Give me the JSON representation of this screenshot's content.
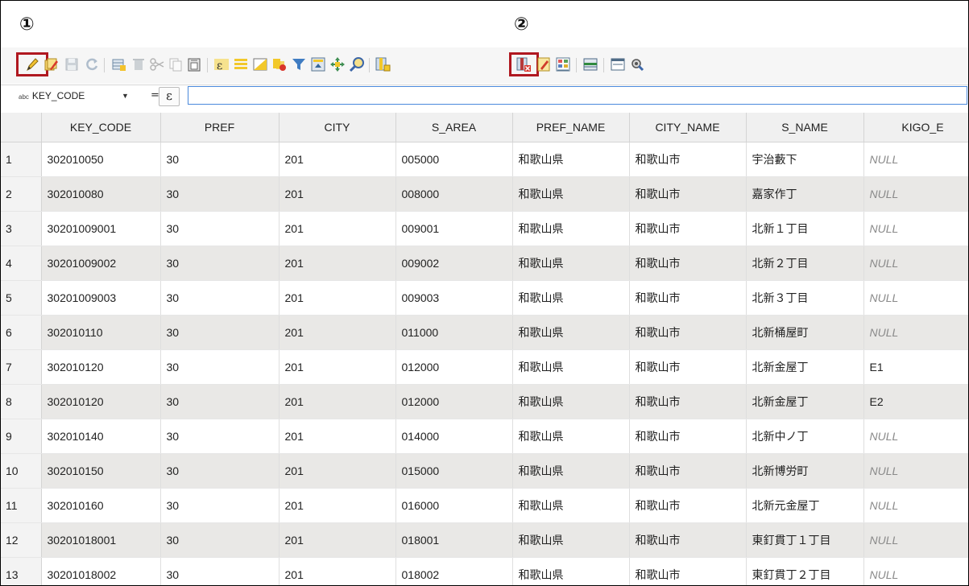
{
  "annotations": [
    "①",
    "②"
  ],
  "toolbar": {
    "icons": [
      "toggle-editing-icon",
      "multi-edit-icon",
      "save-edits-icon",
      "reload-icon",
      "add-feature-icon",
      "delete-feature-icon",
      "cut-icon",
      "copy-icon",
      "paste-icon",
      "select-by-expression-icon",
      "select-all-icon",
      "invert-selection-icon",
      "deselect-all-icon",
      "filter-icon",
      "move-selection-to-top-icon",
      "pan-to-selected-icon",
      "zoom-to-selected-icon",
      "new-field-icon",
      "delete-field-icon",
      "open-field-calculator-icon",
      "conditional-formatting-icon",
      "table-view-icon",
      "dock-table-icon",
      "actions-icon"
    ]
  },
  "expression_bar": {
    "field": "KEY_CODE",
    "field_type_badge": "abc",
    "operator": "=",
    "expr_button": "ε",
    "value": ""
  },
  "table": {
    "columns": [
      "",
      "KEY_CODE",
      "PREF",
      "CITY",
      "S_AREA",
      "PREF_NAME",
      "CITY_NAME",
      "S_NAME",
      "KIGO_E"
    ],
    "rows": [
      [
        "1",
        "302010050",
        "30",
        "201",
        "005000",
        "和歌山県",
        "和歌山市",
        "宇治藪下",
        "NULL"
      ],
      [
        "2",
        "302010080",
        "30",
        "201",
        "008000",
        "和歌山県",
        "和歌山市",
        "嘉家作丁",
        "NULL"
      ],
      [
        "3",
        "30201009001",
        "30",
        "201",
        "009001",
        "和歌山県",
        "和歌山市",
        "北新１丁目",
        "NULL"
      ],
      [
        "4",
        "30201009002",
        "30",
        "201",
        "009002",
        "和歌山県",
        "和歌山市",
        "北新２丁目",
        "NULL"
      ],
      [
        "5",
        "30201009003",
        "30",
        "201",
        "009003",
        "和歌山県",
        "和歌山市",
        "北新３丁目",
        "NULL"
      ],
      [
        "6",
        "302010110",
        "30",
        "201",
        "011000",
        "和歌山県",
        "和歌山市",
        "北新桶屋町",
        "NULL"
      ],
      [
        "7",
        "302010120",
        "30",
        "201",
        "012000",
        "和歌山県",
        "和歌山市",
        "北新金屋丁",
        "E1"
      ],
      [
        "8",
        "302010120",
        "30",
        "201",
        "012000",
        "和歌山県",
        "和歌山市",
        "北新金屋丁",
        "E2"
      ],
      [
        "9",
        "302010140",
        "30",
        "201",
        "014000",
        "和歌山県",
        "和歌山市",
        "北新中ノ丁",
        "NULL"
      ],
      [
        "10",
        "302010150",
        "30",
        "201",
        "015000",
        "和歌山県",
        "和歌山市",
        "北新博労町",
        "NULL"
      ],
      [
        "11",
        "302010160",
        "30",
        "201",
        "016000",
        "和歌山県",
        "和歌山市",
        "北新元金屋丁",
        "NULL"
      ],
      [
        "12",
        "30201018001",
        "30",
        "201",
        "018001",
        "和歌山県",
        "和歌山市",
        "東釘貫丁１丁目",
        "NULL"
      ],
      [
        "13",
        "30201018002",
        "30",
        "201",
        "018002",
        "和歌山県",
        "和歌山市",
        "東釘貫丁２丁目",
        "NULL"
      ]
    ]
  }
}
